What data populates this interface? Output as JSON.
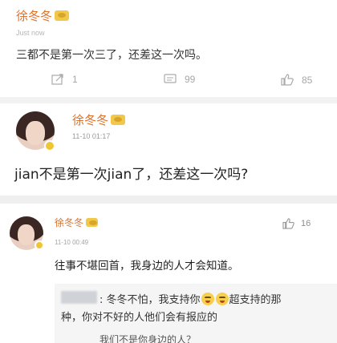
{
  "post1": {
    "username": "徐冬冬",
    "timestamp": "Just now",
    "text": "三都不是第一次三了，还差这一次吗。",
    "actions": {
      "share_count": "1",
      "comment_count": "99",
      "like_count": "85"
    }
  },
  "post2": {
    "username": "徐冬冬",
    "timestamp": "11-10 01:17",
    "text": "jian不是第一次jian了，还差这一次吗?"
  },
  "post3": {
    "username": "徐冬冬",
    "timestamp": "11-10 00:49",
    "like_count": "16",
    "text": "往事不堪回首，我身边的人才会知道。",
    "quote": {
      "line1_a": ": 冬冬不怕，我支持你",
      "line1_b": "超支持的那",
      "line2": "种，你对不好的人他们会有报应的",
      "line3": "我们不是你身边的人？"
    }
  },
  "colors": {
    "username": "#e0712a",
    "separator": "#f2f2f2",
    "quote_bg": "#f5f5f5"
  },
  "icons": [
    "vip-badge-icon",
    "share-icon",
    "comment-icon",
    "like-icon",
    "emoji-icon"
  ]
}
